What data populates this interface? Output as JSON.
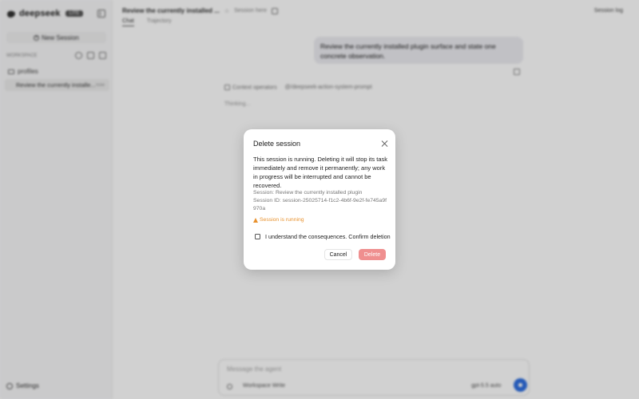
{
  "sidebar": {
    "brand_name": "deepseek",
    "brand_badge": "LITE",
    "new_session_label": "New Session",
    "workspace_label": "WORKSPACE",
    "folder_name": "profiles",
    "session_title": "Review the currently installe...",
    "session_time": "now",
    "settings_label": "Settings"
  },
  "header": {
    "session_title": "Review the currently installed ...",
    "star_label": "Session here",
    "session_log_label": "Session log"
  },
  "tabs": [
    {
      "label": "Chat"
    },
    {
      "label": "Trajectory"
    }
  ],
  "chat": {
    "user_message": "Review the currently installed plugin surface and state one concrete observation.",
    "context_label": "Context operators",
    "prompt_label": "@/deepseek-action-system-prompt",
    "thinking_label": "Thinking..."
  },
  "composer": {
    "placeholder": "Message the agent",
    "workspace_label": "Workspace Write",
    "model_label": "gpt-5.5 auto"
  },
  "modal": {
    "title": "Delete session",
    "description": "This session is running. Deleting it will stop its task immediately and remove it permanently; any work in progress will be interrupted and cannot be recovered.",
    "session_line": "Session: Review the currently installed plugin",
    "session_id_line": "Session ID: session-25025714-f1c2-4b6f-9e2f-fe745a9f970a",
    "running_label": "Session is running",
    "confirm_label": "I understand the consequences. Confirm deletion",
    "cancel_label": "Cancel",
    "delete_label": "Delete"
  },
  "colors": {
    "accent": "#2f6fe0",
    "warning": "#e8912d",
    "danger_disabled": "#ef8f8f"
  }
}
